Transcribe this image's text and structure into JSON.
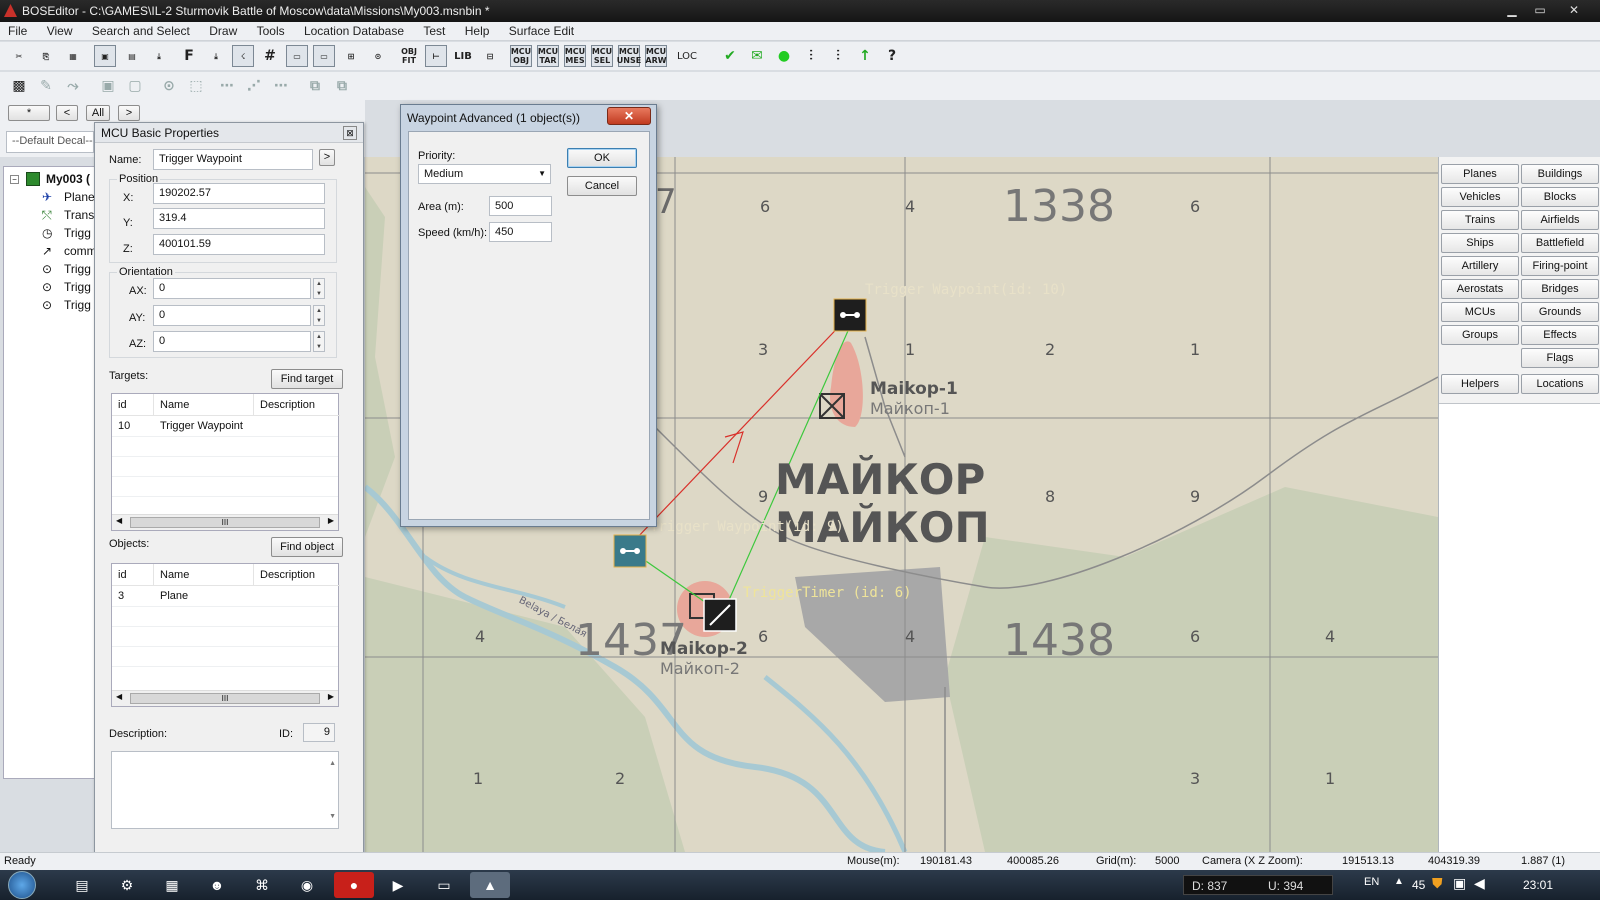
{
  "window": {
    "title": "BOSEditor - C:\\GAMES\\IL-2 Sturmovik Battle of Moscow\\data\\Missions\\My003.msnbin *",
    "min_symbol": "▁",
    "max_symbol": "▭",
    "close_symbol": "✕"
  },
  "menu": [
    "File",
    "View",
    "Search and Select",
    "Draw",
    "Tools",
    "Location Database",
    "Test",
    "Help",
    "Surface Edit"
  ],
  "toolbar1": {
    "buttons": [
      "✂",
      "⎘",
      "▦",
      "▣",
      "▤",
      "⤓",
      "F",
      "⤓",
      "☇",
      "#",
      "▭",
      "▭",
      "⊞",
      "⊙",
      "OBJ FIT",
      "⊢",
      "LIB",
      "⊟",
      "MCU OBJ",
      "MCU TAR",
      "MCU MES",
      "MCU SEL",
      "MCU UNSE",
      "MCU ARW",
      "LOC",
      "✔",
      "✉",
      "●",
      "⫶",
      "⫶",
      "↑",
      "?"
    ]
  },
  "toolbar2": {
    "buttons": [
      "▩",
      "✎",
      "⤳",
      "▣",
      "▢",
      "⊙",
      "⬚",
      "⋯",
      "⋰",
      "⋯",
      "⧉",
      "⧉"
    ]
  },
  "decal_box": {
    "star": "*",
    "prev": "<",
    "all": "All",
    "next": ">",
    "value": "--Default Decal--"
  },
  "tree": {
    "root": "My003 (",
    "items": [
      "Plane",
      "Trans",
      "Trigg",
      "comm",
      "Trigg",
      "Trigg",
      "Trigg"
    ]
  },
  "props": {
    "title": "MCU Basic Properties",
    "name_label": "Name:",
    "name_value": "Trigger Waypoint",
    "name_btn": ">",
    "position_label": "Position",
    "x_label": "X:",
    "x_value": "190202.57",
    "y_label": "Y:",
    "y_value": "319.4",
    "z_label": "Z:",
    "z_value": "400101.59",
    "orientation_label": "Orientation",
    "ax_label": "AX:",
    "ax_value": "0",
    "ay_label": "AY:",
    "ay_value": "0",
    "az_label": "AZ:",
    "az_value": "0",
    "targets_label": "Targets:",
    "find_target": "Find target",
    "targets_cols": [
      "id",
      "Name",
      "Description"
    ],
    "targets_rows": [
      {
        "id": "10",
        "name": "Trigger Waypoint",
        "desc": ""
      }
    ],
    "objects_label": "Objects:",
    "find_object": "Find object",
    "objects_cols": [
      "id",
      "Name",
      "Description"
    ],
    "objects_rows": [
      {
        "id": "3",
        "name": "Plane",
        "desc": ""
      }
    ],
    "scroll_thumb": "III",
    "description_label": "Description:",
    "id_label": "ID:",
    "id_value": "9"
  },
  "dialog": {
    "title": "Waypoint Advanced (1 object(s))",
    "close": "✕",
    "priority_label": "Priority:",
    "priority_value": "Medium",
    "area_label": "Area (m):",
    "area_value": "500",
    "speed_label": "Speed (km/h):",
    "speed_value": "450",
    "ok": "OK",
    "cancel": "Cancel"
  },
  "map": {
    "grid_numbers": [
      "7",
      "6",
      "4",
      "1338",
      "6",
      "3",
      "1",
      "2",
      "1",
      "9",
      "8",
      "9",
      "1437",
      "6",
      "4",
      "1438",
      "6",
      "4",
      "4",
      "1",
      "2",
      "3",
      "1"
    ],
    "airfields": [
      {
        "name": "Maikop-1",
        "name_ru": "Майкоп-1"
      },
      {
        "name": "Maikop-2",
        "name_ru": "Майкоп-2"
      }
    ],
    "city_name": "МАЙКОР",
    "city_name_ru": "МАЙКОП",
    "river_label": "Belaya / Белая",
    "waypoint_labels": [
      "Trigger Waypoint(id: 10)",
      "Trigger Waypoint(id: 9)",
      "TriggerTimer (id: 6)"
    ],
    "colors": {
      "map_bg": "#ddd8c6",
      "water": "#a7c9d3",
      "forest": "#c9cfb7",
      "airfield": "#e8a79a",
      "route_red": "#d9302a",
      "route_green": "#3cc83c"
    }
  },
  "right_panel": {
    "buttons": [
      [
        "Planes",
        "Buildings"
      ],
      [
        "Vehicles",
        "Blocks"
      ],
      [
        "Trains",
        "Airfields"
      ],
      [
        "Ships",
        "Battlefield"
      ],
      [
        "Artillery",
        "Firing-point"
      ],
      [
        "Aerostats",
        "Bridges"
      ],
      [
        "MCUs",
        "Grounds"
      ],
      [
        "Groups",
        "Effects"
      ],
      [
        "",
        "Flags"
      ],
      [
        "Helpers",
        "Locations"
      ]
    ]
  },
  "status": {
    "ready": "Ready",
    "mouse_label": "Mouse(m):",
    "mouse_x": "190181.43",
    "mouse_z": "400085.26",
    "grid_label": "Grid(m):",
    "grid_value": "5000",
    "camera_label": "Camera (X Z Zoom):",
    "camera_x": "191513.13",
    "camera_z": "404319.39",
    "camera_zoom": "1.887 (1)"
  },
  "taskbar": {
    "d_label": "D: 837",
    "u_label": "U: 394",
    "lang": "EN",
    "count": "45",
    "clock": "23:01"
  }
}
